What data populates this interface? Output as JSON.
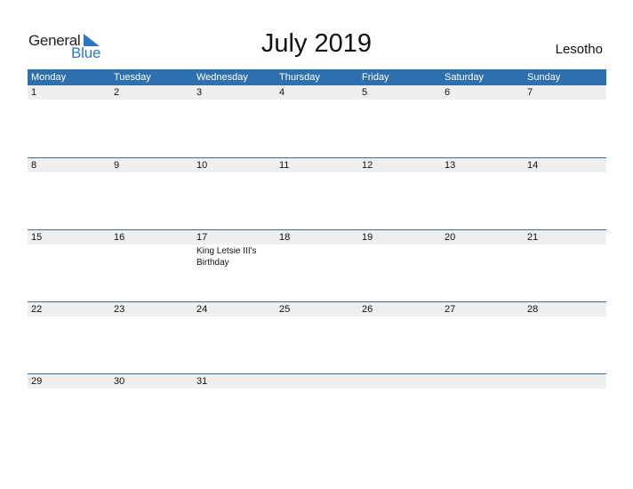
{
  "logo": {
    "general": "General",
    "blue": "Blue"
  },
  "title": "July 2019",
  "country": "Lesotho",
  "colors": {
    "accent": "#2e6fb0",
    "date_band": "#efefef",
    "logo_blue": "#2a78c8"
  },
  "days": [
    "Monday",
    "Tuesday",
    "Wednesday",
    "Thursday",
    "Friday",
    "Saturday",
    "Sunday"
  ],
  "weeks": [
    {
      "dates": [
        "1",
        "2",
        "3",
        "4",
        "5",
        "6",
        "7"
      ],
      "events": [
        "",
        "",
        "",
        "",
        "",
        "",
        ""
      ]
    },
    {
      "dates": [
        "8",
        "9",
        "10",
        "11",
        "12",
        "13",
        "14"
      ],
      "events": [
        "",
        "",
        "",
        "",
        "",
        "",
        ""
      ]
    },
    {
      "dates": [
        "15",
        "16",
        "17",
        "18",
        "19",
        "20",
        "21"
      ],
      "events": [
        "",
        "",
        "King Letsie III's Birthday",
        "",
        "",
        "",
        ""
      ]
    },
    {
      "dates": [
        "22",
        "23",
        "24",
        "25",
        "26",
        "27",
        "28"
      ],
      "events": [
        "",
        "",
        "",
        "",
        "",
        "",
        ""
      ]
    },
    {
      "dates": [
        "29",
        "30",
        "31",
        "",
        "",
        "",
        ""
      ],
      "events": [
        "",
        "",
        "",
        "",
        "",
        "",
        ""
      ]
    }
  ]
}
